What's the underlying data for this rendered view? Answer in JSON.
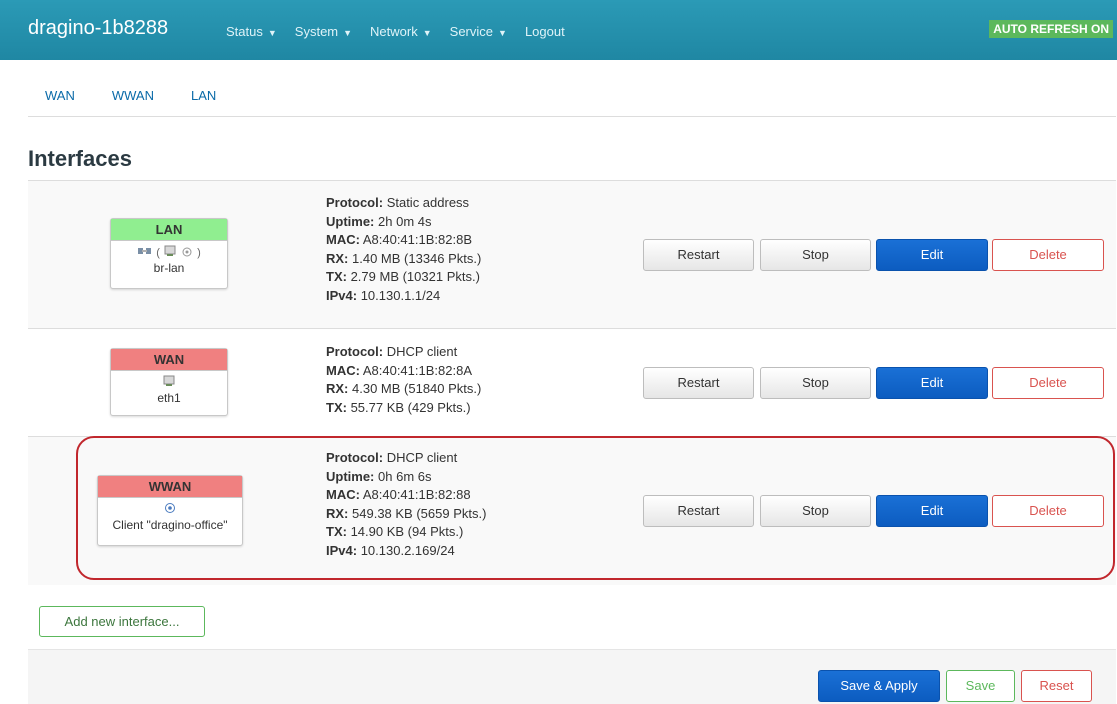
{
  "header": {
    "title": "dragino-1b8288",
    "menu": [
      {
        "label": "Status",
        "dropdown": true
      },
      {
        "label": "System",
        "dropdown": true
      },
      {
        "label": "Network",
        "dropdown": true
      },
      {
        "label": "Service",
        "dropdown": true
      },
      {
        "label": "Logout",
        "dropdown": false
      }
    ],
    "auto_refresh": "AUTO REFRESH ON"
  },
  "tabs": [
    "WAN",
    "WWAN",
    "LAN"
  ],
  "section_title": "Interfaces",
  "interfaces": [
    {
      "name": "LAN",
      "state": "up",
      "icons": "bridge, ethernet, wifi",
      "device": "br-lan",
      "details": [
        {
          "key": "Protocol:",
          "value": "Static address"
        },
        {
          "key": "Uptime:",
          "value": "2h 0m 4s"
        },
        {
          "key": "MAC:",
          "value": "A8:40:41:1B:82:8B"
        },
        {
          "key": "RX:",
          "value": "1.40 MB (13346 Pkts.)"
        },
        {
          "key": "TX:",
          "value": "2.79 MB (10321 Pkts.)"
        },
        {
          "key": "IPv4:",
          "value": "10.130.1.1/24"
        }
      ]
    },
    {
      "name": "WAN",
      "state": "down",
      "icons": "ethernet",
      "device": "eth1",
      "details": [
        {
          "key": "Protocol:",
          "value": "DHCP client"
        },
        {
          "key": "MAC:",
          "value": "A8:40:41:1B:82:8A"
        },
        {
          "key": "RX:",
          "value": "4.30 MB (51840 Pkts.)"
        },
        {
          "key": "TX:",
          "value": "55.77 KB (429 Pkts.)"
        }
      ]
    },
    {
      "name": "WWAN",
      "state": "down",
      "icons": "wifi",
      "device": "Client \"dragino-office\"",
      "details": [
        {
          "key": "Protocol:",
          "value": "DHCP client"
        },
        {
          "key": "Uptime:",
          "value": "0h 6m 6s"
        },
        {
          "key": "MAC:",
          "value": "A8:40:41:1B:82:88"
        },
        {
          "key": "RX:",
          "value": "549.38 KB (5659 Pkts.)"
        },
        {
          "key": "TX:",
          "value": "14.90 KB (94 Pkts.)"
        },
        {
          "key": "IPv4:",
          "value": "10.130.2.169/24"
        }
      ]
    }
  ],
  "row_buttons": {
    "restart": "Restart",
    "stop": "Stop",
    "edit": "Edit",
    "delete": "Delete"
  },
  "add_interface": "Add new interface...",
  "footer": {
    "save_apply": "Save & Apply",
    "save": "Save",
    "reset": "Reset"
  },
  "colors": {
    "navbar": "#2196b5",
    "up": "#90ee90",
    "down": "#f08080",
    "primary": "#0c5cc0",
    "danger": "#d9534f",
    "success": "#5cb85c",
    "highlight": "#c1272d"
  }
}
